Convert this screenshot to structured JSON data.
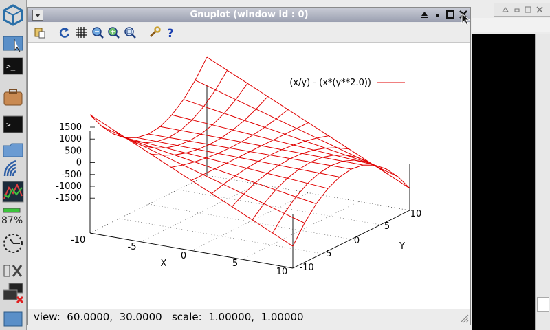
{
  "window": {
    "title": "Gnuplot (window id : 0)"
  },
  "toolbar": {
    "tools": [
      "copy-clipboard-icon",
      "replot-icon",
      "grid-icon",
      "zoom-previous-icon",
      "zoom-next-icon",
      "unzoom-icon",
      "configure-icon",
      "help-icon"
    ]
  },
  "plot": {
    "legend": "(x/y) - (x*(y**2.0))",
    "z_ticks": [
      "1500",
      "1000",
      "500",
      "0",
      "-500",
      "-1000",
      "-1500"
    ],
    "x_ticks": [
      "-10",
      "-5",
      "0",
      "5",
      "10"
    ],
    "y_ticks": [
      "-10",
      "-5",
      "0",
      "5",
      "10"
    ],
    "x_label": "X",
    "y_label": "Y",
    "line_color": "#e00000"
  },
  "status": {
    "text": "view:  60.0000,  30.0000   scale:  1.00000,  1.00000"
  },
  "dock": {
    "battery": "87%",
    "items": [
      "os-logo-icon",
      "desktop-icon",
      "terminal-icon",
      "briefcase-icon",
      "terminal-icon",
      "folder-icon",
      "wireless-icon",
      "chart-app-icon",
      "battery-icon",
      "clock-icon",
      "settings-icon",
      "display-icon",
      "window-icon"
    ]
  }
}
